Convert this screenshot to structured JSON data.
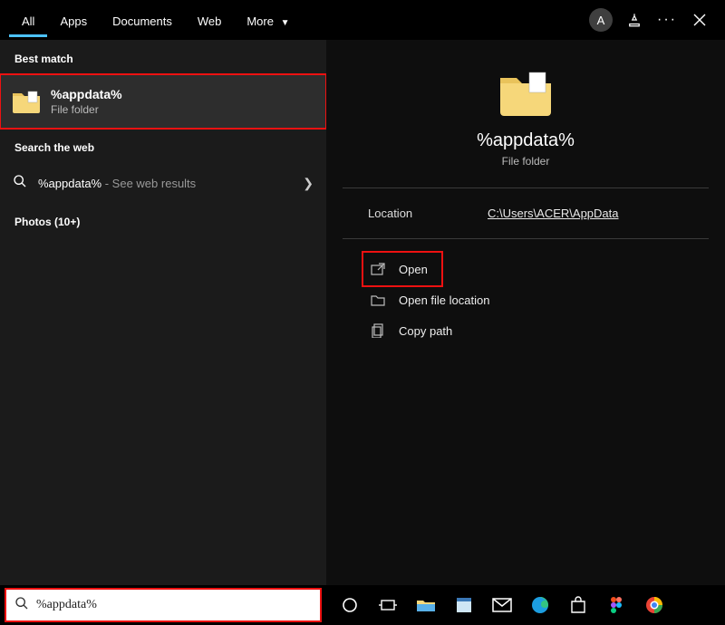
{
  "tabs": {
    "all": "All",
    "apps": "Apps",
    "documents": "Documents",
    "web": "Web",
    "more": "More"
  },
  "titlebar": {
    "avatar_letter": "A"
  },
  "left": {
    "best_match_label": "Best match",
    "best_match": {
      "title": "%appdata%",
      "subtitle": "File folder"
    },
    "search_web_label": "Search the web",
    "web_result": {
      "query": "%appdata%",
      "suffix": " - See web results"
    },
    "photos_label": "Photos (10+)"
  },
  "detail": {
    "title": "%appdata%",
    "subtitle": "File folder",
    "location_key": "Location",
    "location_value": "C:\\Users\\ACER\\AppData",
    "actions": {
      "open": "Open",
      "open_file_location": "Open file location",
      "copy_path": "Copy path"
    }
  },
  "search": {
    "value": "%appdata%"
  }
}
